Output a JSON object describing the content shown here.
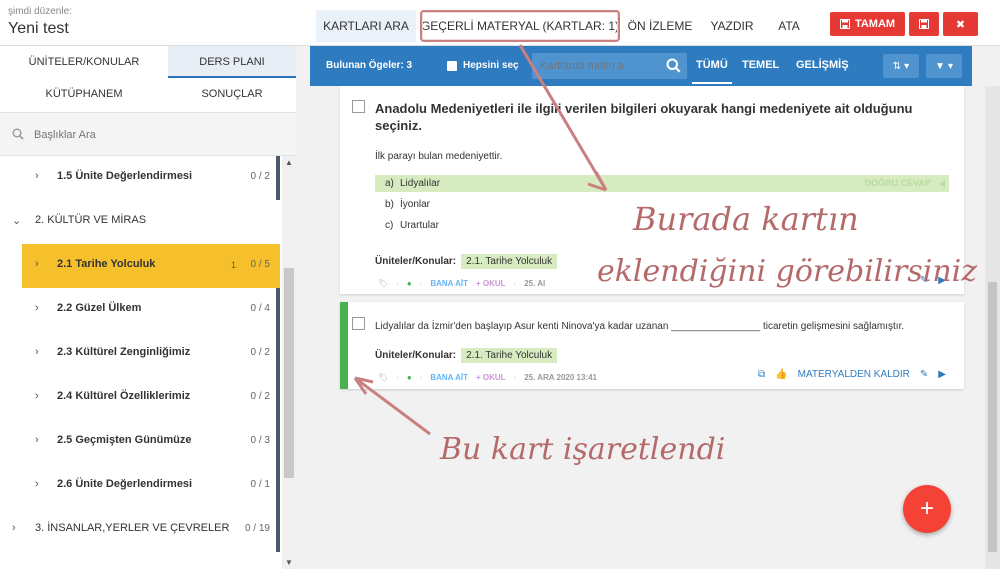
{
  "header": {
    "caption": "şimdi düzenle:",
    "title": "Yeni test",
    "tabs": [
      {
        "label": "KARTLARI ARA",
        "active": true
      },
      {
        "label": "GEÇERLİ MATERYAL (KARTLAR: 1)",
        "active": false
      },
      {
        "label": "ÖN İZLEME",
        "active": false
      },
      {
        "label": "YAZDIR",
        "active": false
      },
      {
        "label": "ATA",
        "active": false
      }
    ],
    "save_label": "TAMAM",
    "icons": [
      "save-icon",
      "floppy-icon",
      "close-icon"
    ]
  },
  "sidebar": {
    "tabs": [
      {
        "label": "ÜNİTELER/KONULAR"
      },
      {
        "label": "DERS PLANI"
      },
      {
        "label": "KÜTÜPHANEM"
      },
      {
        "label": "SONUÇLAR"
      }
    ],
    "search_placeholder": "Başlıklar Ara",
    "tree": [
      {
        "label": "1.5 Ünite Değerlendirmesi",
        "count": "0 / 2"
      },
      {
        "label": "2. KÜLTÜR VE MİRAS"
      },
      {
        "label": "2.1 Tarihe Yolculuk",
        "badge": "1",
        "count": "0 / 5"
      },
      {
        "label": "2.2 Güzel Ülkem",
        "count": "0 / 4"
      },
      {
        "label": "2.3 Kültürel Zenginliğimiz",
        "count": "0 / 2"
      },
      {
        "label": "2.4 Kültürel Özelliklerimiz",
        "count": "0 / 2"
      },
      {
        "label": "2.5 Geçmişten Günümüze",
        "count": "0 / 3"
      },
      {
        "label": "2.6 Ünite Değerlendirmesi",
        "count": "0 / 1"
      },
      {
        "label": "3. İNSANLAR,YERLER VE ÇEVRELER",
        "count": "0 / 19"
      }
    ]
  },
  "toolbar": {
    "found_label": "Bulunan Ögeler: 3",
    "select_all": "Hepsini seç",
    "search_placeholder": "Kartlarda metin a",
    "filters": [
      {
        "label": "TÜMÜ",
        "active": true
      },
      {
        "label": "TEMEL",
        "active": false
      },
      {
        "label": "GELİŞMİŞ",
        "active": false
      }
    ]
  },
  "cards": [
    {
      "question": "Anadolu Medeniyetleri ile ilgili verilen bilgileri okuyarak hangi medeniyete ait olduğunu seçiniz.",
      "stem": "İlk parayı bulan medeniyettir.",
      "options": [
        {
          "letter": "a)",
          "text": "Lidyalılar",
          "correct": true
        },
        {
          "letter": "b)",
          "text": "İyonlar",
          "correct": false
        },
        {
          "letter": "c)",
          "text": "Urartular",
          "correct": false
        }
      ],
      "correct_label": "DOĞRU CEVAP",
      "topic_label": "Üniteler/Konular:",
      "topic": "2.1. Tarihe Yolculuk",
      "owner": "BANA AİT",
      "school": "+ OKUL",
      "date": "25. AI"
    },
    {
      "question": "Lidyalılar da İzmir'den başlayıp Asur kenti Ninova'ya kadar uzanan ________________ ticaretin gelişmesini sağlamıştır.",
      "topic_label": "Üniteler/Konular:",
      "topic": "2.1. Tarihe Yolculuk",
      "owner": "BANA AİT",
      "school": "+ OKUL",
      "date": "25. ARA 2020 13:41",
      "remove_label": "MATERYALDEN KALDIR"
    }
  ],
  "annotations": {
    "note1_line1": "Burada kartın",
    "note1_line2": "eklendiğini görebilirsiniz",
    "note2": "Bu kart işaretlendi"
  },
  "fab_label": "+"
}
